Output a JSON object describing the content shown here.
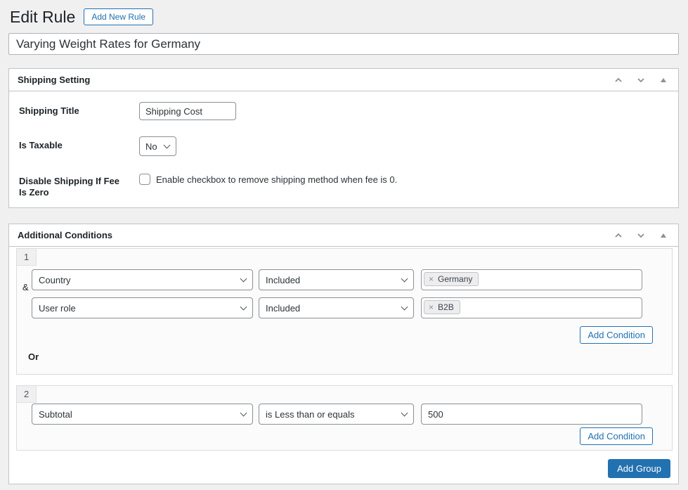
{
  "page": {
    "title": "Edit Rule",
    "add_new_rule_label": "Add New Rule"
  },
  "rule_name": {
    "value": "Varying Weight Rates for Germany"
  },
  "shipping_setting": {
    "title": "Shipping Setting",
    "shipping_title": {
      "label": "Shipping Title",
      "value": "Shipping Cost"
    },
    "is_taxable": {
      "label": "Is Taxable",
      "value": "No"
    },
    "disable_if_zero": {
      "label": "Disable Shipping If Fee Is Zero",
      "description": "Enable checkbox to remove shipping method when fee is 0.",
      "checked": false
    }
  },
  "conditions": {
    "title": "Additional Conditions",
    "add_condition_label": "Add Condition",
    "add_group_label": "Add Group",
    "groups": [
      {
        "number": "1",
        "join_label": "&",
        "or_label": "Or",
        "rows": [
          {
            "field": "Country",
            "operator": "Included",
            "tags": [
              {
                "remove": "×",
                "label": "Germany"
              }
            ]
          },
          {
            "field": "User role",
            "operator": "Included",
            "tags": [
              {
                "remove": "×",
                "label": "B2B"
              }
            ]
          }
        ]
      },
      {
        "number": "2",
        "rows": [
          {
            "field": "Subtotal",
            "operator": "is Less than or equals",
            "value": "500"
          }
        ]
      }
    ]
  },
  "colors": {
    "accent": "#2271b1",
    "panel_border": "#c3c4c7",
    "page_bg": "#f0f0f1"
  }
}
